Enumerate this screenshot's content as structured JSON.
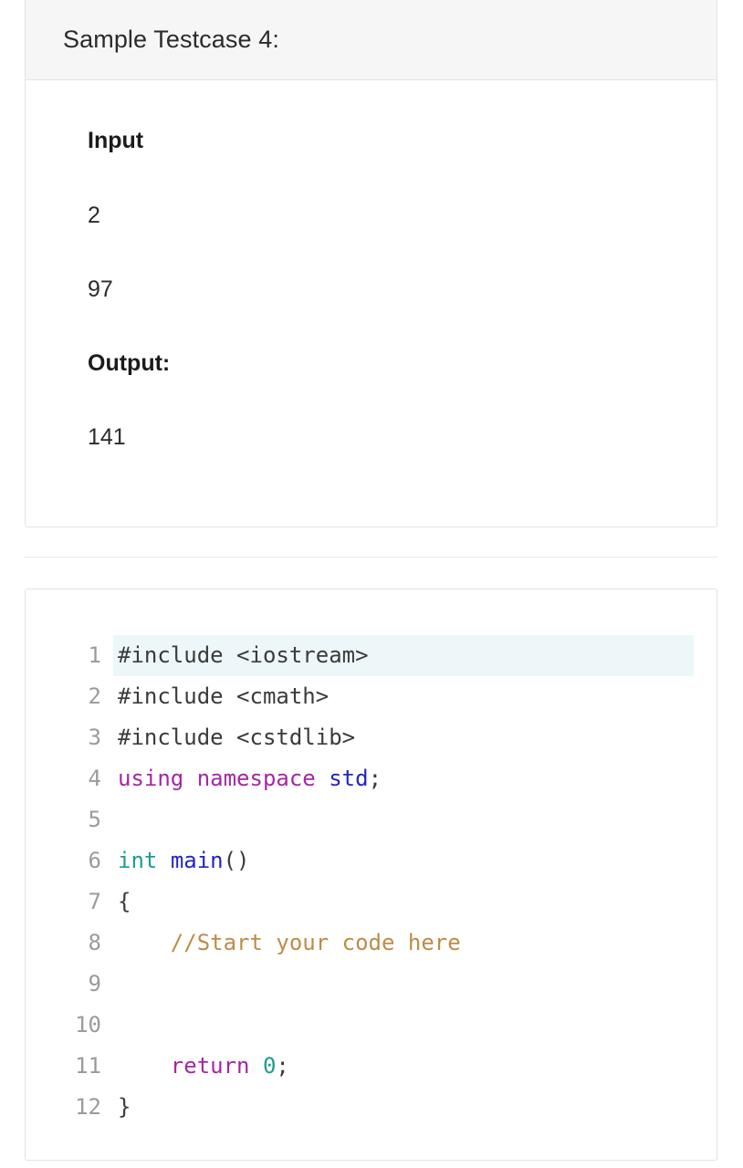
{
  "testcase": {
    "header_title": "Sample Testcase 4:",
    "input_label": "Input",
    "input_lines": [
      "2",
      "97"
    ],
    "output_label": "Output:",
    "output_lines": [
      "141"
    ]
  },
  "editor": {
    "active_line": 1,
    "line_numbers": [
      "1",
      "2",
      "3",
      "4",
      "5",
      "6",
      "7",
      "8",
      "9",
      "10",
      "11",
      "12"
    ],
    "lines": [
      "#include <iostream>",
      "#include <cmath>",
      "#include <cstdlib>",
      "using namespace std;",
      "",
      "int main()",
      "{",
      "    //Start your code here",
      "",
      "",
      "    return 0;",
      "}"
    ],
    "tokens": [
      [
        {
          "t": "#include <iostream>",
          "c": "tok-plain"
        }
      ],
      [
        {
          "t": "#include <cmath>",
          "c": "tok-plain"
        }
      ],
      [
        {
          "t": "#include <cstdlib>",
          "c": "tok-plain"
        }
      ],
      [
        {
          "t": "using",
          "c": "tok-keyword"
        },
        {
          "t": " ",
          "c": "tok-plain"
        },
        {
          "t": "namespace",
          "c": "tok-keyword"
        },
        {
          "t": " ",
          "c": "tok-plain"
        },
        {
          "t": "std",
          "c": "tok-builtin"
        },
        {
          "t": ";",
          "c": "tok-punct"
        }
      ],
      [],
      [
        {
          "t": "int",
          "c": "tok-type"
        },
        {
          "t": " ",
          "c": "tok-plain"
        },
        {
          "t": "main",
          "c": "tok-builtin"
        },
        {
          "t": "()",
          "c": "tok-punct"
        }
      ],
      [
        {
          "t": "{",
          "c": "tok-punct"
        }
      ],
      [
        {
          "t": "    ",
          "c": "tok-plain"
        },
        {
          "t": "//Start your code here",
          "c": "tok-comment"
        }
      ],
      [],
      [],
      [
        {
          "t": "    ",
          "c": "tok-plain"
        },
        {
          "t": "return",
          "c": "tok-keyword"
        },
        {
          "t": " ",
          "c": "tok-plain"
        },
        {
          "t": "0",
          "c": "tok-number"
        },
        {
          "t": ";",
          "c": "tok-punct"
        }
      ],
      [
        {
          "t": "}",
          "c": "tok-punct"
        }
      ]
    ]
  },
  "colors": {
    "card_border": "#e3e3e3",
    "header_bg": "#f6f6f6",
    "active_line_bg": "#edf7f9",
    "gutter_text": "#9b9b9b",
    "keyword": "#a626a4",
    "type": "#1a9e8f",
    "builtin": "#2424c4",
    "comment": "#bf8b46",
    "text": "#3b3b3b"
  }
}
